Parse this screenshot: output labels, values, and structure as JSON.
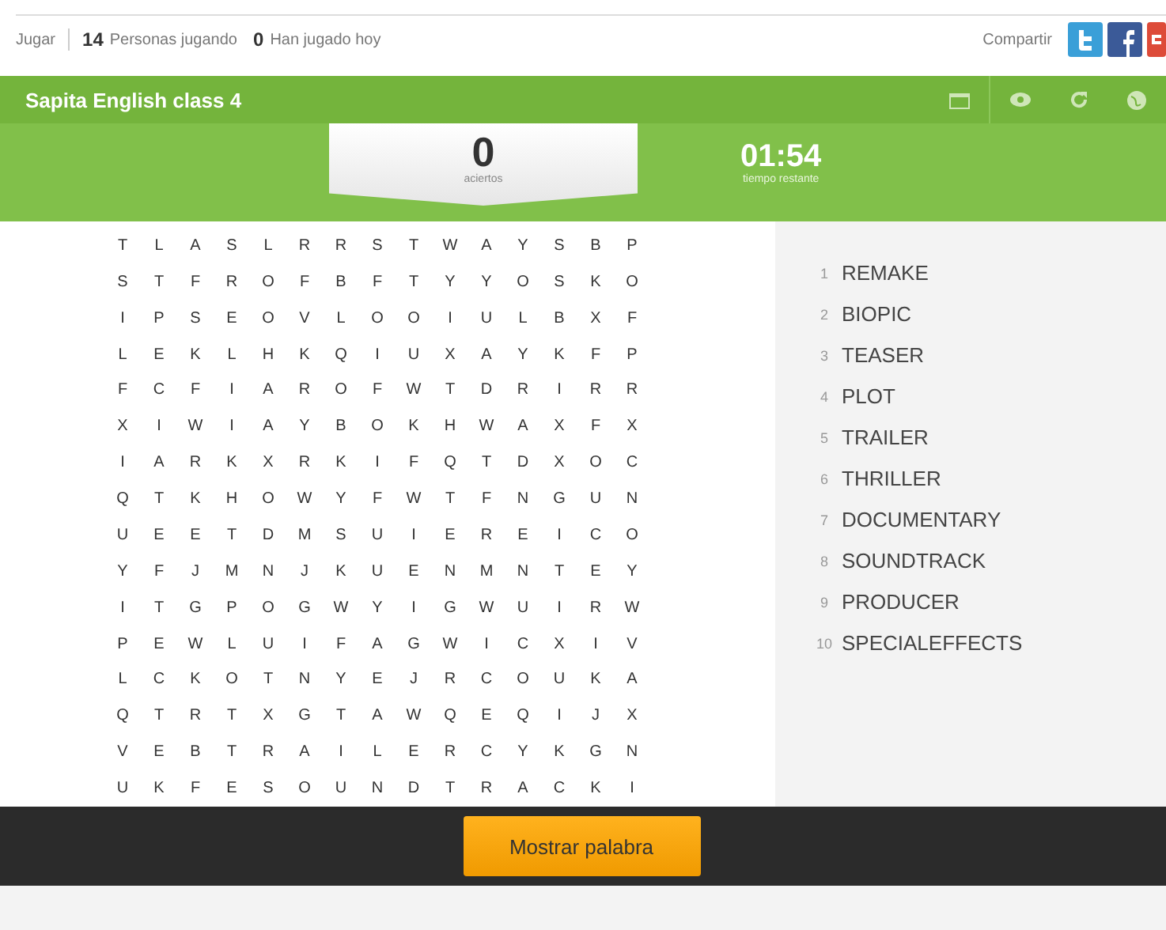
{
  "info_bar": {
    "play_link": "Jugar",
    "players_count": "14",
    "players_label": "Personas jugando",
    "played_count": "0",
    "played_label": "Han jugado hoy",
    "share_label": "Compartir"
  },
  "header": {
    "title": "Sapita English class 4",
    "score": "0",
    "score_label": "aciertos",
    "timer": "01:54",
    "timer_label": "tiempo restante"
  },
  "grid": [
    [
      "T",
      "L",
      "A",
      "S",
      "L",
      "R",
      "R",
      "S",
      "T",
      "W",
      "A",
      "Y",
      "S",
      "B",
      "P"
    ],
    [
      "S",
      "T",
      "F",
      "R",
      "O",
      "F",
      "B",
      "F",
      "T",
      "Y",
      "Y",
      "O",
      "S",
      "K",
      "O"
    ],
    [
      "I",
      "P",
      "S",
      "E",
      "O",
      "V",
      "L",
      "O",
      "O",
      "I",
      "U",
      "L",
      "B",
      "X",
      "F"
    ],
    [
      "L",
      "E",
      "K",
      "L",
      "H",
      "K",
      "Q",
      "I",
      "U",
      "X",
      "A",
      "Y",
      "K",
      "F",
      "P"
    ],
    [
      "F",
      "C",
      "F",
      "I",
      "A",
      "R",
      "O",
      "F",
      "W",
      "T",
      "D",
      "R",
      "I",
      "R",
      "R"
    ],
    [
      "X",
      "I",
      "W",
      "I",
      "A",
      "Y",
      "B",
      "O",
      "K",
      "H",
      "W",
      "A",
      "X",
      "F",
      "X"
    ],
    [
      "I",
      "A",
      "R",
      "K",
      "X",
      "R",
      "K",
      "I",
      "F",
      "Q",
      "T",
      "D",
      "X",
      "O",
      "C"
    ],
    [
      "Q",
      "T",
      "K",
      "H",
      "O",
      "W",
      "Y",
      "F",
      "W",
      "T",
      "F",
      "N",
      "G",
      "U",
      "N"
    ],
    [
      "U",
      "E",
      "E",
      "T",
      "D",
      "M",
      "S",
      "U",
      "I",
      "E",
      "R",
      "E",
      "I",
      "C",
      "O"
    ],
    [
      "Y",
      "F",
      "J",
      "M",
      "N",
      "J",
      "K",
      "U",
      "E",
      "N",
      "M",
      "N",
      "T",
      "E",
      "Y"
    ],
    [
      "I",
      "T",
      "G",
      "P",
      "O",
      "G",
      "W",
      "Y",
      "I",
      "G",
      "W",
      "U",
      "I",
      "R",
      "W"
    ],
    [
      "P",
      "E",
      "W",
      "L",
      "U",
      "I",
      "F",
      "A",
      "G",
      "W",
      "I",
      "C",
      "X",
      "I",
      "V"
    ],
    [
      "L",
      "C",
      "K",
      "O",
      "T",
      "N",
      "Y",
      "E",
      "J",
      "R",
      "C",
      "O",
      "U",
      "K",
      "A"
    ],
    [
      "Q",
      "T",
      "R",
      "T",
      "X",
      "G",
      "T",
      "A",
      "W",
      "Q",
      "E",
      "Q",
      "I",
      "J",
      "X"
    ],
    [
      "V",
      "E",
      "B",
      "T",
      "R",
      "A",
      "I",
      "L",
      "E",
      "R",
      "C",
      "Y",
      "K",
      "G",
      "N"
    ],
    [
      "U",
      "K",
      "F",
      "E",
      "S",
      "O",
      "U",
      "N",
      "D",
      "T",
      "R",
      "A",
      "C",
      "K",
      "I"
    ]
  ],
  "words": [
    {
      "number": "1",
      "word": "REMAKE"
    },
    {
      "number": "2",
      "word": "BIOPIC"
    },
    {
      "number": "3",
      "word": "TEASER"
    },
    {
      "number": "4",
      "word": "PLOT"
    },
    {
      "number": "5",
      "word": "TRAILER"
    },
    {
      "number": "6",
      "word": "THRILLER"
    },
    {
      "number": "7",
      "word": "DOCUMENTARY"
    },
    {
      "number": "8",
      "word": "SOUNDTRACK"
    },
    {
      "number": "9",
      "word": "PRODUCER"
    },
    {
      "number": "10",
      "word": "SPECIALEFFECTS"
    }
  ],
  "footer": {
    "button": "Mostrar palabra"
  }
}
